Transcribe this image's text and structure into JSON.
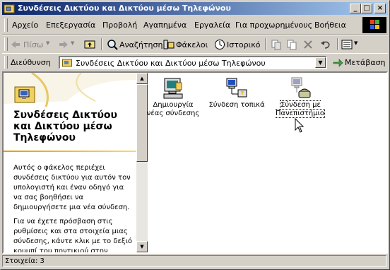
{
  "window": {
    "title": "Συνδέσεις Δικτύου και Δικτύου μέσω Τηλεφώνου"
  },
  "menu": [
    "Αρχείο",
    "Επεξεργασία",
    "Προβολή",
    "Αγαπημένα",
    "Εργαλεία",
    "Για προχωρημένους",
    "Βοήθεια"
  ],
  "toolbar": {
    "back": "Πίσω",
    "search": "Αναζήτηση",
    "folders": "Φάκελοι",
    "history": "Ιστορικό"
  },
  "address": {
    "label": "Διεύθυνση",
    "value": "Συνδέσεις Δικτύου και Δικτύου μέσω Τηλεφώνου",
    "go": "Μετάβαση"
  },
  "leftpane": {
    "title": "Συνδέσεις Δικτύου και Δικτύου μέσω Τηλεφώνου",
    "para1": "Αυτός ο φάκελος περιέχει συνδέσεις δικτύου για αυτόν τον υπολογιστή και έναν οδηγό για να σας βοηθήσει να δημιουργήσετε μια νέα σύνδεση.",
    "para2": "Για να έχετε πρόσβαση στις ρυθμίσεις και στα στοιχεία μιας σύνδεσης, κάντε κλικ με το δεξιό κουμπί του ποντικιού στην επιλογή"
  },
  "items": [
    {
      "label": "Δημιουργία νέας σύνδεσης",
      "icon": "new-connection-wizard-icon"
    },
    {
      "label": "Σύνδεση τοπικά",
      "icon": "lan-connection-icon"
    },
    {
      "label": "Σύνδεση με Πανεπιστήμιο",
      "icon": "dialup-connection-icon"
    }
  ],
  "status": {
    "text": "Στοιχεία: 3"
  }
}
